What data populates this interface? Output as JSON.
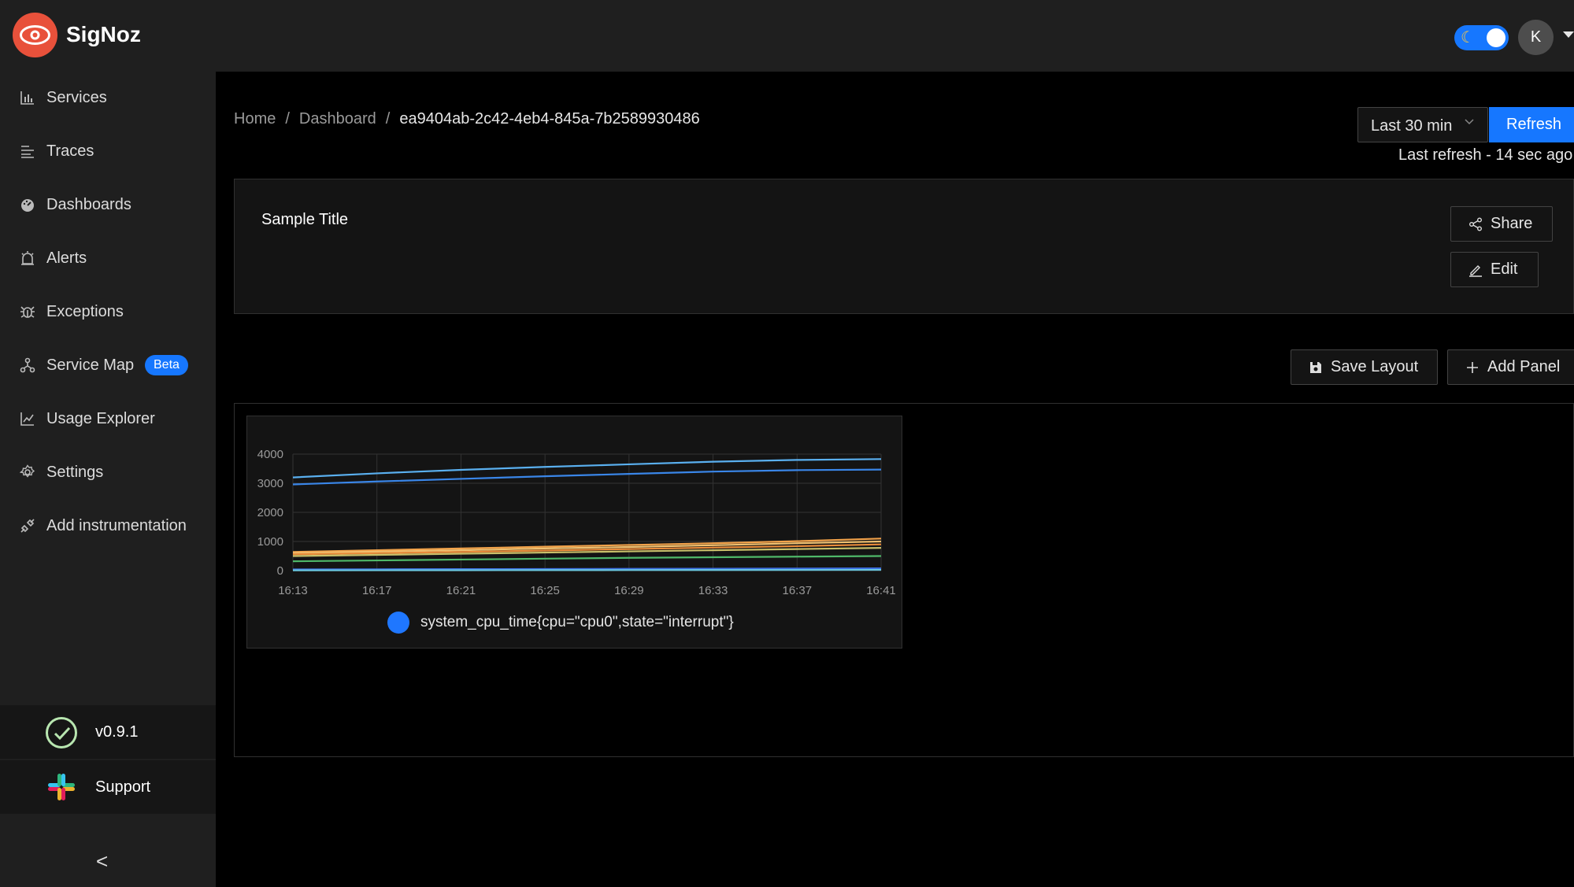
{
  "app": {
    "brand": "SigNoz",
    "avatar_initial": "K"
  },
  "sidebar": {
    "items": [
      {
        "label": "Services",
        "icon": "bar-chart-icon"
      },
      {
        "label": "Traces",
        "icon": "list-icon"
      },
      {
        "label": "Dashboards",
        "icon": "dashboard-icon"
      },
      {
        "label": "Alerts",
        "icon": "alarm-icon"
      },
      {
        "label": "Exceptions",
        "icon": "bug-icon"
      },
      {
        "label": "Service Map",
        "icon": "deployment-unit-icon",
        "badge": "Beta"
      },
      {
        "label": "Usage Explorer",
        "icon": "line-chart-icon"
      },
      {
        "label": "Settings",
        "icon": "gear-icon"
      },
      {
        "label": "Add instrumentation",
        "icon": "api-icon"
      }
    ],
    "version": "v0.9.1",
    "support": "Support",
    "collapse_glyph": "<"
  },
  "breadcrumb": {
    "home": "Home",
    "separator": "/",
    "dashboard": "Dashboard",
    "current": "ea9404ab-2c42-4eb4-845a-7b2589930486"
  },
  "time_controls": {
    "selected": "Last 30 min",
    "refresh_label": "Refresh",
    "last_refresh": "Last refresh - 14 sec ago"
  },
  "dashboard": {
    "title": "Sample Title",
    "share_label": "Share",
    "edit_label": "Edit",
    "save_layout_label": "Save Layout",
    "add_panel_label": "Add Panel"
  },
  "chart_data": {
    "type": "line",
    "x": [
      "16:13",
      "16:17",
      "16:21",
      "16:25",
      "16:29",
      "16:33",
      "16:37",
      "16:41"
    ],
    "ylim": [
      0,
      4000
    ],
    "yticks": [
      0,
      1000,
      2000,
      3000,
      4000
    ],
    "grid": true,
    "legend_position": "bottom",
    "legend": [
      "system_cpu_time{cpu=\"cpu0\",state=\"interrupt\"}"
    ],
    "series": [
      {
        "color": "#5ab0f0",
        "values": [
          3200,
          3340,
          3460,
          3560,
          3650,
          3740,
          3800,
          3830
        ]
      },
      {
        "color": "#3a86e8",
        "values": [
          2960,
          3060,
          3150,
          3240,
          3320,
          3400,
          3450,
          3470
        ]
      },
      {
        "color": "#f2a24a",
        "values": [
          640,
          700,
          760,
          820,
          880,
          940,
          1010,
          1100
        ]
      },
      {
        "color": "#f0c070",
        "values": [
          600,
          650,
          700,
          760,
          810,
          870,
          940,
          1000
        ]
      },
      {
        "color": "#e98b3a",
        "values": [
          560,
          600,
          640,
          690,
          740,
          790,
          840,
          900
        ]
      },
      {
        "color": "#c9c06a",
        "values": [
          500,
          540,
          580,
          620,
          660,
          700,
          740,
          780
        ]
      },
      {
        "color": "#4fb869",
        "values": [
          320,
          350,
          380,
          410,
          440,
          460,
          480,
          500
        ]
      },
      {
        "color": "#3d6fe0",
        "values": [
          40,
          45,
          50,
          55,
          60,
          65,
          70,
          80
        ]
      },
      {
        "color": "#6ac7e0",
        "values": [
          10,
          12,
          14,
          16,
          18,
          20,
          22,
          25
        ]
      }
    ]
  }
}
